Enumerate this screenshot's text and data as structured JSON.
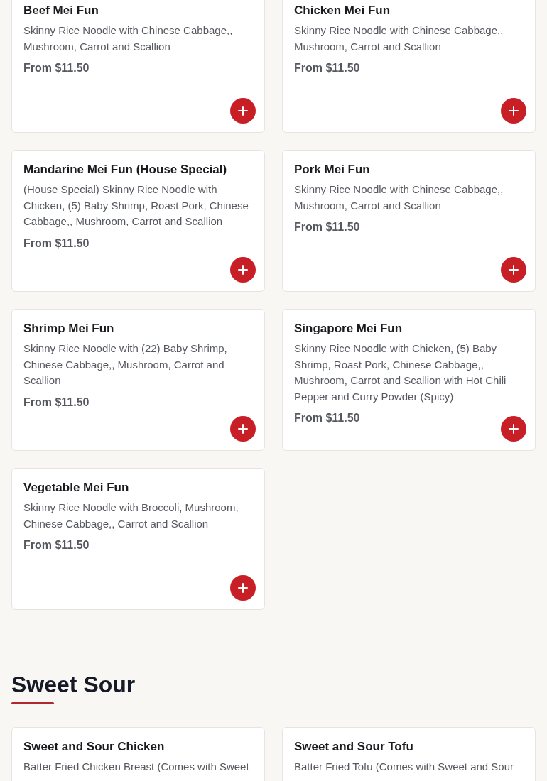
{
  "sections": [
    {
      "items": [
        {
          "name": "Beef Mei Fun",
          "description": "Skinny Rice Noodle with Chinese Cabbage,, Mushroom, Carrot and Scallion",
          "price": "From $11.50"
        },
        {
          "name": "Chicken Mei Fun",
          "description": "Skinny Rice Noodle with Chinese Cabbage,, Mushroom, Carrot and Scallion",
          "price": "From $11.50"
        },
        {
          "name": "Mandarine Mei Fun (House Special)",
          "description": "(House Special) Skinny Rice Noodle with Chicken, (5) Baby Shrimp, Roast Pork, Chinese Cabbage,, Mushroom, Carrot and Scallion",
          "price": "From $11.50"
        },
        {
          "name": "Pork Mei Fun",
          "description": "Skinny Rice Noodle with Chinese Cabbage,, Mushroom, Carrot and Scallion",
          "price": "From $11.50"
        },
        {
          "name": "Shrimp Mei Fun",
          "description": "Skinny Rice Noodle with (22) Baby Shrimp, Chinese Cabbage,, Mushroom, Carrot and Scallion",
          "price": "From $11.50"
        },
        {
          "name": "Singapore Mei Fun",
          "description": "Skinny Rice Noodle with Chicken, (5) Baby Shrimp, Roast Pork, Chinese Cabbage,, Mushroom, Carrot and Scallion with Hot Chili Pepper and Curry Powder (Spicy)",
          "price": "From $11.50"
        },
        {
          "name": "Vegetable Mei Fun",
          "description": "Skinny Rice Noodle with Broccoli, Mushroom, Chinese Cabbage,, Carrot and Scallion",
          "price": "From $11.50"
        }
      ]
    },
    {
      "title": "Sweet Sour",
      "items": [
        {
          "name": "Sweet and Sour Chicken",
          "description": "Batter Fried Chicken Breast (Comes with Sweet"
        },
        {
          "name": "Sweet and Sour Tofu",
          "description": "Batter Fried Tofu (Comes with Sweet and Sour"
        }
      ]
    }
  ]
}
